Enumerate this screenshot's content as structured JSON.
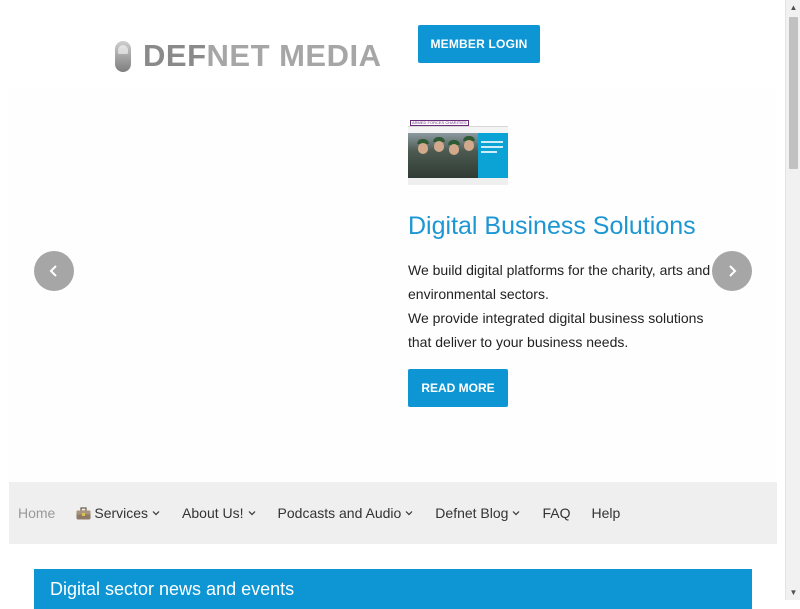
{
  "header": {
    "logo": {
      "word1": "DEF",
      "word2": "NET MEDIA"
    },
    "login_label": "MEMBER LOGIN"
  },
  "slider": {
    "thumbnail_tag": "ARMED FORCES CHARITIES",
    "title": "Digital Business Solutions",
    "text_line1": "We build digital platforms for the charity, arts and environmental sectors.",
    "text_line2": "We provide integrated digital business solutions that deliver to your business needs.",
    "read_more_label": "READ MORE",
    "prev_icon": "chevron-left-icon",
    "next_icon": "chevron-right-icon"
  },
  "nav": {
    "items": [
      {
        "label": "Home",
        "active": true,
        "dropdown": false
      },
      {
        "label": "Services",
        "active": false,
        "dropdown": true,
        "icon": "briefcase-icon"
      },
      {
        "label": "About Us!",
        "active": false,
        "dropdown": true
      },
      {
        "label": "Podcasts and Audio",
        "active": false,
        "dropdown": true
      },
      {
        "label": "Defnet Blog",
        "active": false,
        "dropdown": true
      },
      {
        "label": "FAQ",
        "active": false,
        "dropdown": false
      },
      {
        "label": "Help",
        "active": false,
        "dropdown": false
      }
    ]
  },
  "news": {
    "heading": "Digital sector news and events"
  },
  "colors": {
    "accent": "#0d95d4",
    "title_blue": "#1d97d3",
    "nav_bg": "#efefef",
    "arrow_grey": "#a6a6a6"
  }
}
